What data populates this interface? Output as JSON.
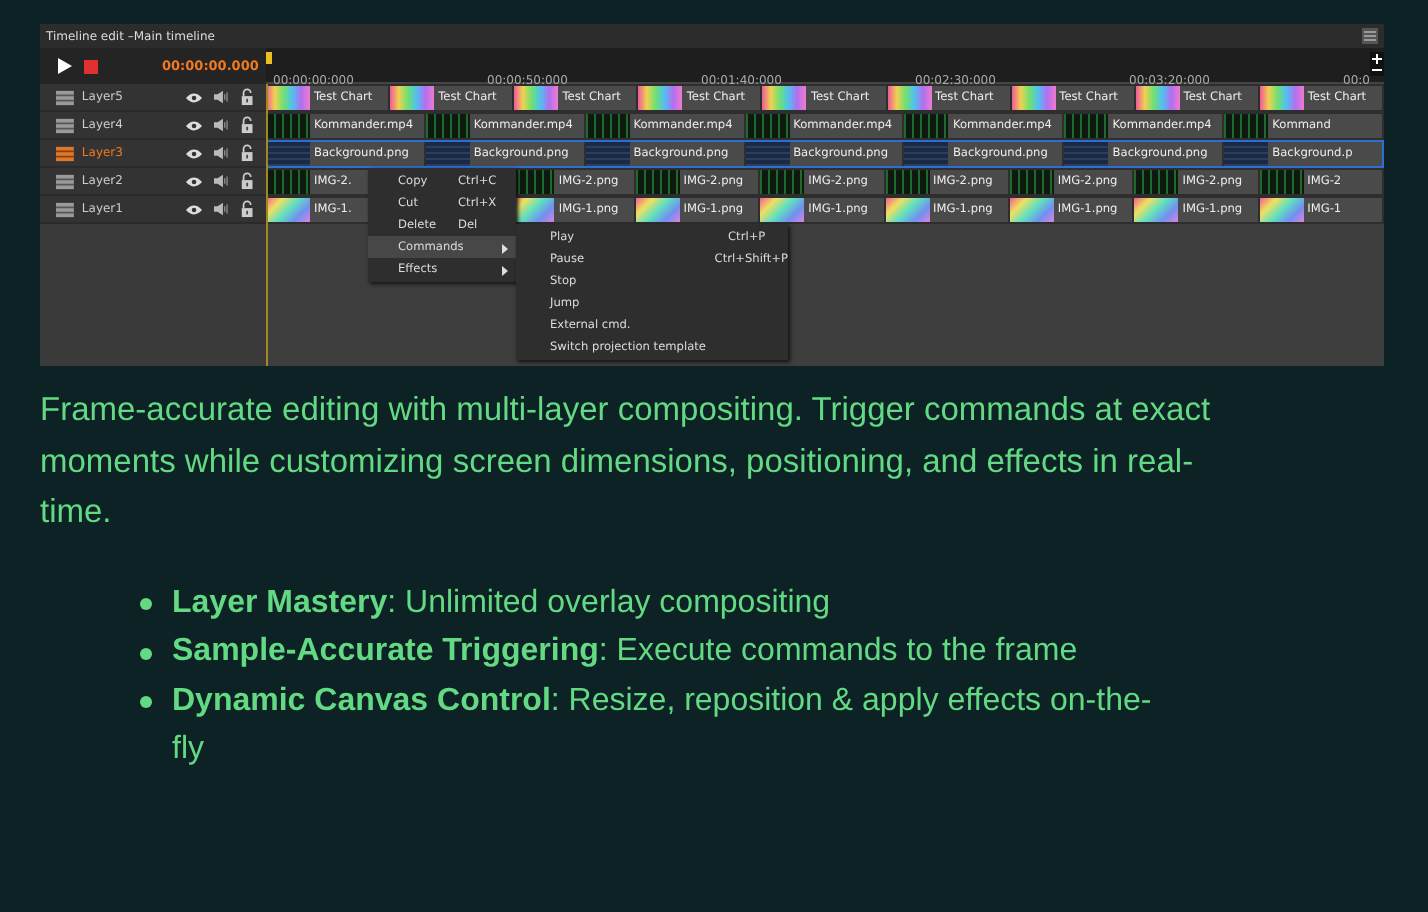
{
  "window": {
    "title": "Timeline edit –Main timeline"
  },
  "toolbar": {
    "timecode": "00:00:00.000"
  },
  "ruler": {
    "labels": [
      "00:00:00:000",
      "00:00:50:000",
      "00:01:40:000",
      "00:02:30:000",
      "00:03:20:000",
      "00:0"
    ]
  },
  "layers": [
    {
      "name": "Layer5",
      "selected": false,
      "kind": "rainbow",
      "clips": [
        "Test Chart",
        "Test Chart",
        "Test Chart",
        "Test Chart",
        "Test Chart",
        "Test Chart",
        "Test Chart",
        "Test Chart",
        "Test Chart"
      ]
    },
    {
      "name": "Layer4",
      "selected": false,
      "kind": "scope",
      "clips": [
        "Kommander.mp4",
        "Kommander.mp4",
        "Kommander.mp4",
        "Kommander.mp4",
        "Kommander.mp4",
        "Kommander.mp4",
        "Kommand"
      ]
    },
    {
      "name": "Layer3",
      "selected": true,
      "kind": "slate",
      "clips": [
        "Background.png",
        "Background.png",
        "Background.png",
        "Background.png",
        "Background.png",
        "Background.png",
        "Background.p"
      ]
    },
    {
      "name": "Layer2",
      "selected": false,
      "kind": "scope",
      "clips": [
        "IMG-2.",
        "IMG-2.png",
        "IMG-2.png",
        "IMG-2.png",
        "IMG-2.png",
        "IMG-2.png",
        "IMG-2.png",
        "IMG-2"
      ]
    },
    {
      "name": "Layer1",
      "selected": false,
      "kind": "pastel",
      "clips": [
        "IMG-1.",
        "IMG-1.png",
        "IMG-1.png",
        "IMG-1.png",
        "IMG-1.png",
        "IMG-1.png",
        "IMG-1.png",
        "IMG-1"
      ]
    }
  ],
  "context_menu": {
    "items": [
      {
        "label": "Copy",
        "shortcut": "Ctrl+C",
        "has_submenu": false,
        "selected": false
      },
      {
        "label": "Cut",
        "shortcut": "Ctrl+X",
        "has_submenu": false,
        "selected": false
      },
      {
        "label": "Delete",
        "shortcut": "Del",
        "has_submenu": false,
        "selected": false
      },
      {
        "label": "Commands",
        "has_submenu": true,
        "selected": true
      },
      {
        "label": "Effects",
        "has_submenu": true,
        "selected": false
      }
    ]
  },
  "submenu": {
    "items": [
      {
        "label": "Play",
        "shortcut": "Ctrl+P"
      },
      {
        "label": "Pause",
        "shortcut": "Ctrl+Shift+P"
      },
      {
        "label": "Stop"
      },
      {
        "label": "Jump"
      },
      {
        "label": "External cmd."
      },
      {
        "label": "Switch projection template"
      }
    ]
  },
  "description": "Frame-accurate editing with multi-layer compositing. Trigger commands at exact moments while customizing screen dimensions, positioning, and effects in real-time.",
  "features": [
    "**Layer Mastery**: Unlimited overlay compositing",
    "**Sample-Accurate Triggering**: Execute commands to the frame",
    "**Dynamic Canvas Control**: Resize, reposition & apply effects on-the-fly"
  ]
}
